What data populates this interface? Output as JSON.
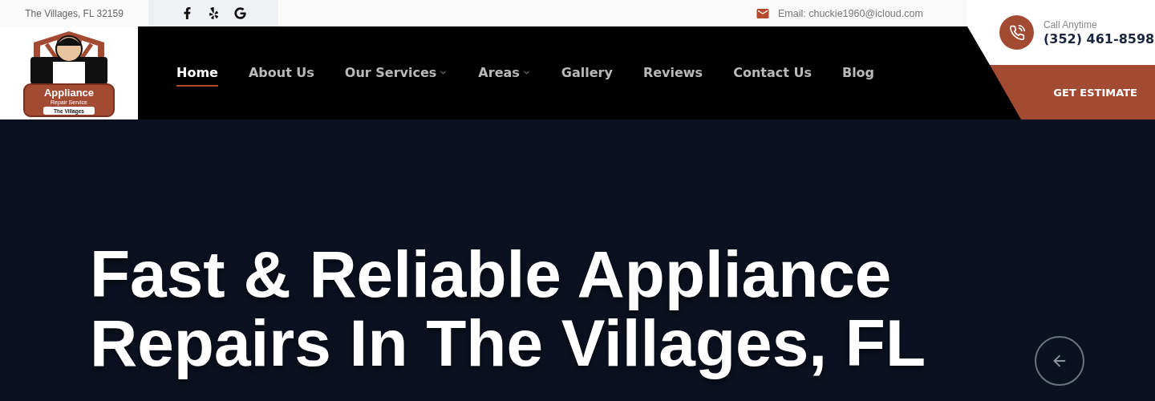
{
  "top_bar": {
    "address": "The Villages, FL 32159",
    "social": [
      {
        "kind": "facebook"
      },
      {
        "kind": "yelp"
      },
      {
        "kind": "google"
      }
    ],
    "email": "Email: chuckie1960@icloud.com"
  },
  "logo": {
    "title": "Appliance",
    "subtitle": "Repair Service",
    "location": "The Villages"
  },
  "nav": [
    {
      "label": "Home",
      "selected": true,
      "dropdown": false
    },
    {
      "label": "About Us",
      "selected": false,
      "dropdown": false
    },
    {
      "label": "Our Services",
      "selected": false,
      "dropdown": true
    },
    {
      "label": "Areas",
      "selected": false,
      "dropdown": true
    },
    {
      "label": "Gallery",
      "selected": false,
      "dropdown": false
    },
    {
      "label": "Reviews",
      "selected": false,
      "dropdown": false
    },
    {
      "label": "Contact Us",
      "selected": false,
      "dropdown": false
    },
    {
      "label": "Blog",
      "selected": false,
      "dropdown": false
    }
  ],
  "contact": {
    "label": "Call Anytime",
    "phone": "(352) 461-8598"
  },
  "cta": "GET ESTIMATE",
  "hero": {
    "heading_lines": [
      "Fast & Reliable Appliance",
      "Repairs In The Villages, FL"
    ]
  }
}
